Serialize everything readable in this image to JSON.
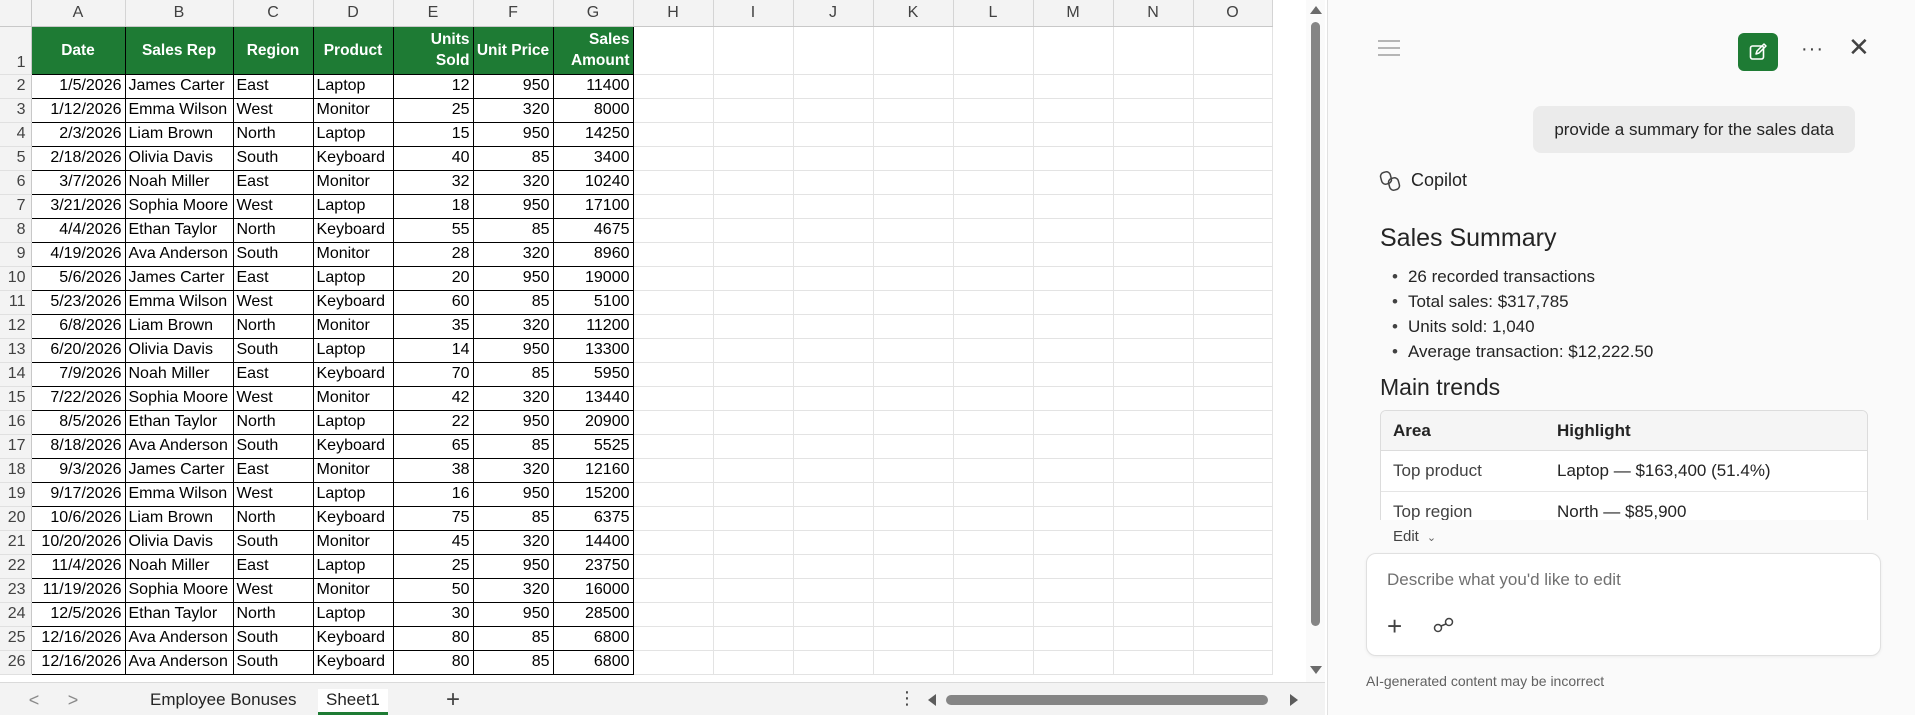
{
  "sheet": {
    "columns": [
      "A",
      "B",
      "C",
      "D",
      "E",
      "F",
      "G",
      "H",
      "I",
      "J",
      "K",
      "L",
      "M",
      "N",
      "O"
    ],
    "header_row": [
      "Date",
      "Sales Rep",
      "Region",
      "Product",
      "Units Sold",
      "Unit Price",
      "Sales Amount"
    ],
    "rows": [
      [
        "1/5/2026",
        "James Carter",
        "East",
        "Laptop",
        "12",
        "950",
        "11400"
      ],
      [
        "1/12/2026",
        "Emma Wilson",
        "West",
        "Monitor",
        "25",
        "320",
        "8000"
      ],
      [
        "2/3/2026",
        "Liam Brown",
        "North",
        "Laptop",
        "15",
        "950",
        "14250"
      ],
      [
        "2/18/2026",
        "Olivia Davis",
        "South",
        "Keyboard",
        "40",
        "85",
        "3400"
      ],
      [
        "3/7/2026",
        "Noah Miller",
        "East",
        "Monitor",
        "32",
        "320",
        "10240"
      ],
      [
        "3/21/2026",
        "Sophia Moore",
        "West",
        "Laptop",
        "18",
        "950",
        "17100"
      ],
      [
        "4/4/2026",
        "Ethan Taylor",
        "North",
        "Keyboard",
        "55",
        "85",
        "4675"
      ],
      [
        "4/19/2026",
        "Ava Anderson",
        "South",
        "Monitor",
        "28",
        "320",
        "8960"
      ],
      [
        "5/6/2026",
        "James Carter",
        "East",
        "Laptop",
        "20",
        "950",
        "19000"
      ],
      [
        "5/23/2026",
        "Emma Wilson",
        "West",
        "Keyboard",
        "60",
        "85",
        "5100"
      ],
      [
        "6/8/2026",
        "Liam Brown",
        "North",
        "Monitor",
        "35",
        "320",
        "11200"
      ],
      [
        "6/20/2026",
        "Olivia Davis",
        "South",
        "Laptop",
        "14",
        "950",
        "13300"
      ],
      [
        "7/9/2026",
        "Noah Miller",
        "East",
        "Keyboard",
        "70",
        "85",
        "5950"
      ],
      [
        "7/22/2026",
        "Sophia Moore",
        "West",
        "Monitor",
        "42",
        "320",
        "13440"
      ],
      [
        "8/5/2026",
        "Ethan Taylor",
        "North",
        "Laptop",
        "22",
        "950",
        "20900"
      ],
      [
        "8/18/2026",
        "Ava Anderson",
        "South",
        "Keyboard",
        "65",
        "85",
        "5525"
      ],
      [
        "9/3/2026",
        "James Carter",
        "East",
        "Monitor",
        "38",
        "320",
        "12160"
      ],
      [
        "9/17/2026",
        "Emma Wilson",
        "West",
        "Laptop",
        "16",
        "950",
        "15200"
      ],
      [
        "10/6/2026",
        "Liam Brown",
        "North",
        "Keyboard",
        "75",
        "85",
        "6375"
      ],
      [
        "10/20/2026",
        "Olivia Davis",
        "South",
        "Monitor",
        "45",
        "320",
        "14400"
      ],
      [
        "11/4/2026",
        "Noah Miller",
        "East",
        "Laptop",
        "25",
        "950",
        "23750"
      ],
      [
        "11/19/2026",
        "Sophia Moore",
        "West",
        "Monitor",
        "50",
        "320",
        "16000"
      ],
      [
        "12/5/2026",
        "Ethan Taylor",
        "North",
        "Laptop",
        "30",
        "950",
        "28500"
      ],
      [
        "12/16/2026",
        "Ava Anderson",
        "South",
        "Keyboard",
        "80",
        "85",
        "6800"
      ],
      [
        "12/16/2026",
        "Ava Anderson",
        "South",
        "Keyboard",
        "80",
        "85",
        "6800"
      ]
    ],
    "header_color": "#1e7b34"
  },
  "tabs": {
    "items": [
      "Employee Bonuses",
      "Sheet1"
    ],
    "active": "Sheet1",
    "nav_prev": "<",
    "nav_next": ">",
    "add": "+",
    "more": "⋮"
  },
  "copilot": {
    "name": "Copilot",
    "user_message": "provide a summary for the sales data",
    "summary_title": "Sales Summary",
    "summary_items": [
      "26 recorded transactions",
      "Total sales: $317,785",
      "Units sold: 1,040",
      "Average transaction: $12,222.50"
    ],
    "trends_title": "Main trends",
    "trends_headers": [
      "Area",
      "Highlight"
    ],
    "trends_rows": [
      [
        "Top product",
        "Laptop — $163,400 (51.4%)"
      ],
      [
        "Top region",
        "North — $85,900"
      ]
    ],
    "edit_mode": "Edit",
    "composer_placeholder": "Describe what you'd like to edit",
    "disclaimer": "AI-generated content may be incorrect",
    "more_label": "···",
    "close_label": "✕",
    "accent": "#1e7b34"
  }
}
